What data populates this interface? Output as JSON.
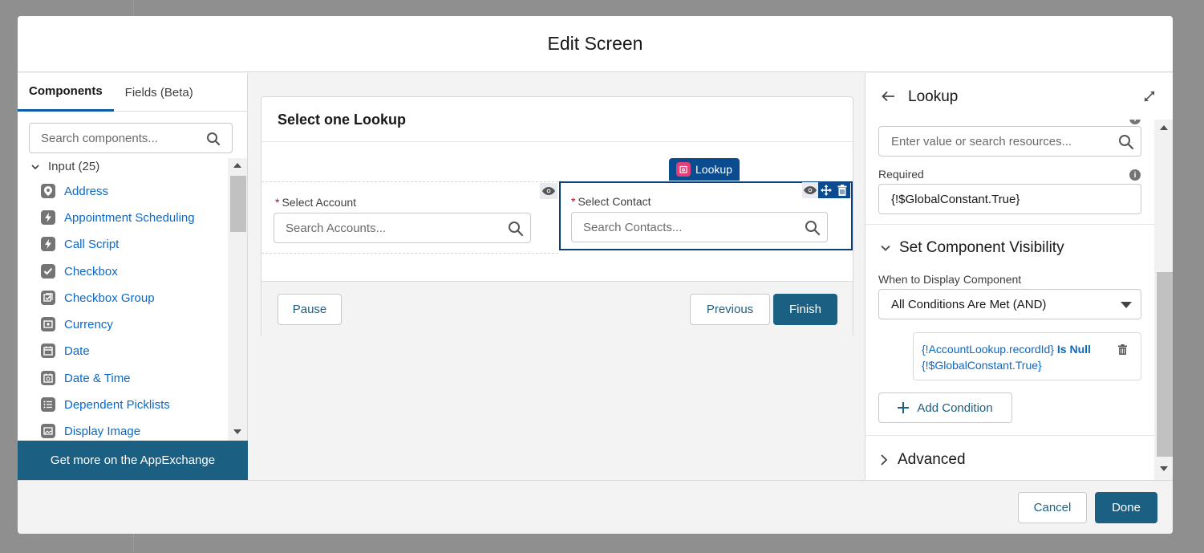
{
  "modal": {
    "title": "Edit Screen"
  },
  "left_panel": {
    "tabs": [
      {
        "label": "Components",
        "active": true
      },
      {
        "label": "Fields (Beta)",
        "active": false
      }
    ],
    "search_placeholder": "Search components...",
    "section_label": "Input (25)",
    "items": [
      {
        "label": "Address",
        "icon": "location-pin-icon"
      },
      {
        "label": "Appointment Scheduling",
        "icon": "lightning-icon"
      },
      {
        "label": "Call Script",
        "icon": "lightning-icon"
      },
      {
        "label": "Checkbox",
        "icon": "checkbox-icon"
      },
      {
        "label": "Checkbox Group",
        "icon": "checkbox-group-icon"
      },
      {
        "label": "Currency",
        "icon": "currency-icon"
      },
      {
        "label": "Date",
        "icon": "calendar-icon"
      },
      {
        "label": "Date & Time",
        "icon": "calendar-time-icon"
      },
      {
        "label": "Dependent Picklists",
        "icon": "list-icon"
      },
      {
        "label": "Display Image",
        "icon": "image-icon"
      }
    ],
    "appexchange_label": "Get more on the AppExchange"
  },
  "canvas": {
    "screen_title": "Select one Lookup",
    "lookup_badge": "Lookup",
    "fields": [
      {
        "label": "Select Account",
        "placeholder": "Search Accounts...",
        "required_mark": "*"
      },
      {
        "label": "Select Contact",
        "placeholder": "Search Contacts...",
        "required_mark": "*"
      }
    ],
    "buttons": {
      "pause": "Pause",
      "previous": "Previous",
      "finish": "Finish"
    }
  },
  "right_panel": {
    "title": "Lookup",
    "value_placeholder": "Enter value or search resources...",
    "required_label": "Required",
    "required_value": "{!$GlobalConstant.True}",
    "visibility_section": "Set Component Visibility",
    "when_label": "When to Display Component",
    "when_value": "All Conditions Are Met (AND)",
    "condition": {
      "resource": "{!AccountLookup.recordId}",
      "operator": "Is Null",
      "value": "{!$GlobalConstant.True}"
    },
    "add_condition": "Add Condition",
    "advanced_section": "Advanced"
  },
  "footer": {
    "cancel": "Cancel",
    "done": "Done"
  },
  "colors": {
    "brand": "#1b5f82",
    "link": "#0b68c7",
    "selection": "#0b4b8f",
    "lookup_icon": "#e3407b"
  }
}
